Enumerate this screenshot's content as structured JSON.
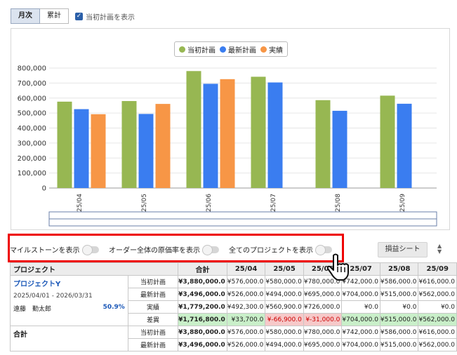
{
  "tabs": [
    {
      "label": "月次",
      "active": true
    },
    {
      "label": "累計",
      "active": false
    }
  ],
  "show_initial_plan": {
    "label": "当初計画を表示",
    "checked": true
  },
  "chart_data": {
    "type": "bar",
    "categories": [
      "25/04",
      "25/05",
      "25/06",
      "25/07",
      "25/08",
      "25/09"
    ],
    "series": [
      {
        "name": "当初計画",
        "color": "#97b752",
        "values": [
          576000,
          580000,
          780000,
          742000,
          586000,
          616000
        ]
      },
      {
        "name": "最新計画",
        "color": "#3a7df0",
        "values": [
          526000,
          494000,
          695000,
          704000,
          515000,
          562000
        ]
      },
      {
        "name": "実績",
        "color": "#f79646",
        "values": [
          492300,
          560900,
          726000,
          null,
          null,
          null
        ]
      }
    ],
    "ylim": [
      0,
      800000
    ],
    "yticks": [
      "800,000",
      "700,000",
      "600,000",
      "500,000",
      "400,000",
      "300,000",
      "200,000",
      "100,000",
      "0"
    ],
    "legend": "top-center",
    "grid": true
  },
  "toggles": [
    {
      "label": "マイルストーンを表示",
      "on": false
    },
    {
      "label": "オーダー全体の原価率を表示",
      "on": false
    },
    {
      "label": "全てのプロジェクトを表示",
      "on": false
    }
  ],
  "pl_sheet_button": "損益シート",
  "table": {
    "headers": {
      "project": "プロジェクト",
      "total": "合計",
      "months": [
        "25/04",
        "25/05",
        "25/06",
        "25/07",
        "25/08",
        "25/09"
      ]
    },
    "project": {
      "name": "プロジェクトY",
      "period": "2025/04/01 - 2026/03/31",
      "manager": "遠藤　勤太郎",
      "rate": "50.9%",
      "rows": [
        {
          "label": "当初計画",
          "total": "¥3,880,000.0",
          "values": [
            "¥576,000.0",
            "¥580,000.0",
            "¥780,000.0",
            "¥742,000.0",
            "¥586,000.0",
            "¥616,000.0"
          ]
        },
        {
          "label": "最新計画",
          "total": "¥3,496,000.0",
          "values": [
            "¥526,000.0",
            "¥494,000.0",
            "¥695,000.0",
            "¥704,000.0",
            "¥515,000.0",
            "¥562,000.0"
          ]
        },
        {
          "label": "実績",
          "total": "¥1,779,200.0",
          "values": [
            "¥492,300.0",
            "¥560,900.0",
            "¥726,000.0",
            "¥0.0",
            "¥0.0",
            "¥0.0"
          ]
        },
        {
          "label": "差異",
          "total": "¥1,716,800.0",
          "values": [
            "¥33,700.0",
            "¥-66,900.0",
            "¥-31,000.0",
            "¥704,000.0",
            "¥515,000.0",
            "¥562,000.0"
          ]
        }
      ]
    },
    "summary": {
      "label": "合計",
      "rows": [
        {
          "label": "当初計画",
          "total": "¥3,880,000.0",
          "values": [
            "¥576,000.0",
            "¥580,000.0",
            "¥780,000.0",
            "¥742,000.0",
            "¥586,000.0",
            "¥616,000.0"
          ]
        },
        {
          "label": "最新計画",
          "total": "¥3,496,000.0",
          "values": [
            "¥526,000.0",
            "¥494,000.0",
            "¥695,000.0",
            "¥704,000.0",
            "¥515,000.0",
            "¥562,000.0"
          ]
        }
      ]
    }
  }
}
